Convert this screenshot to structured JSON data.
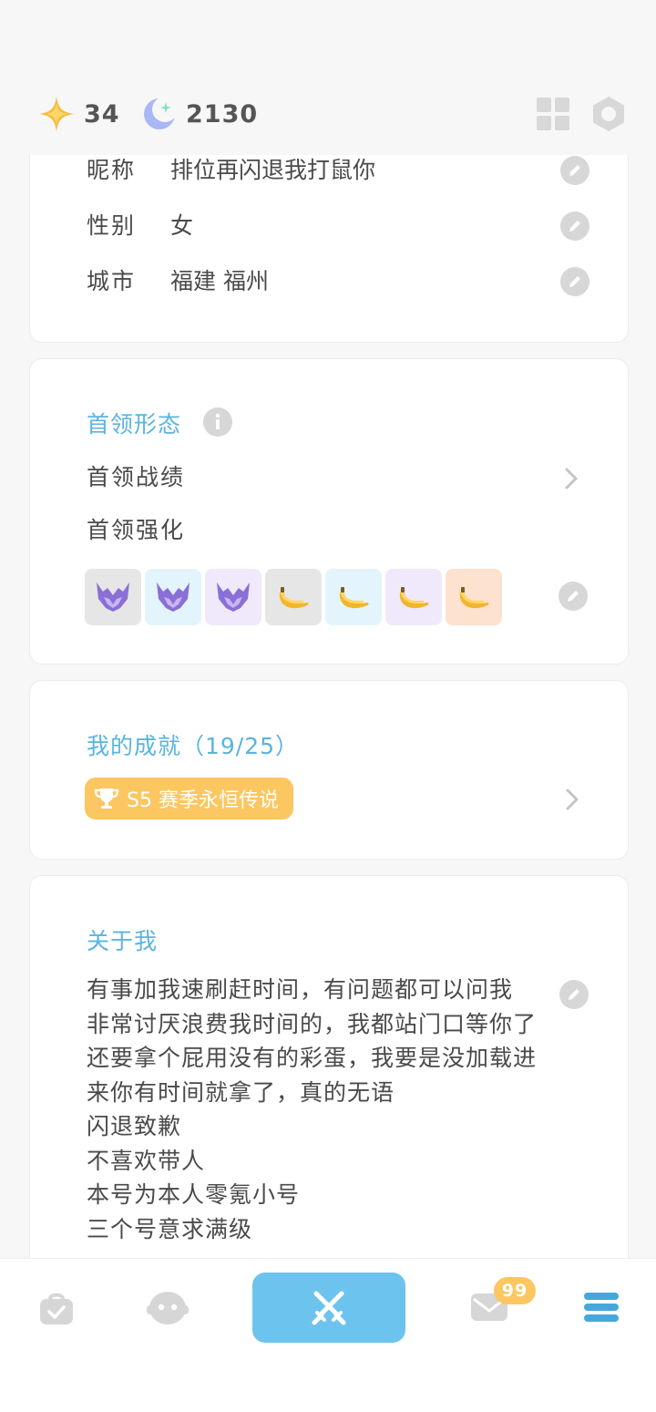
{
  "currency": {
    "star_count": "34",
    "moon_count": "2130"
  },
  "profile": {
    "rows": [
      {
        "label": "昵称",
        "value": "排位再闪退我打鼠你"
      },
      {
        "label": "性别",
        "value": "女"
      },
      {
        "label": "城市",
        "value": "福建 福州"
      }
    ]
  },
  "boss": {
    "title": "首领形态",
    "record_label": "首领战绩",
    "enhance_label": "首领强化",
    "items": [
      {
        "icon": "purple-mask-icon",
        "bg": "#e6e6e6"
      },
      {
        "icon": "purple-mask-icon",
        "bg": "#e3f4fc"
      },
      {
        "icon": "purple-mask-icon",
        "bg": "#efe9fb"
      },
      {
        "icon": "banana-icon",
        "bg": "#e6e6e6"
      },
      {
        "icon": "banana-icon",
        "bg": "#e3f4fc"
      },
      {
        "icon": "banana-icon",
        "bg": "#efe9fb"
      },
      {
        "icon": "banana-icon",
        "bg": "#fde2cf"
      }
    ]
  },
  "achievements": {
    "title": "我的成就（19/25）",
    "badge_label": "S5 赛季永恒传说"
  },
  "about": {
    "title": "关于我",
    "text": "有事加我速刷赶时间，有问题都可以问我\n非常讨厌浪费我时间的，我都站门口等你了还要拿个屁用没有的彩蛋，我要是没加载进来你有时间就拿了，真的无语\n闪退致歉\n不喜欢带人\n本号为本人零氪小号\n三个号意求满级"
  },
  "bottom_nav": {
    "mail_badge": "99"
  },
  "colors": {
    "accent_blue": "#5ab4df",
    "center_button": "#6cc4ee",
    "badge_yellow": "#fcc660"
  }
}
